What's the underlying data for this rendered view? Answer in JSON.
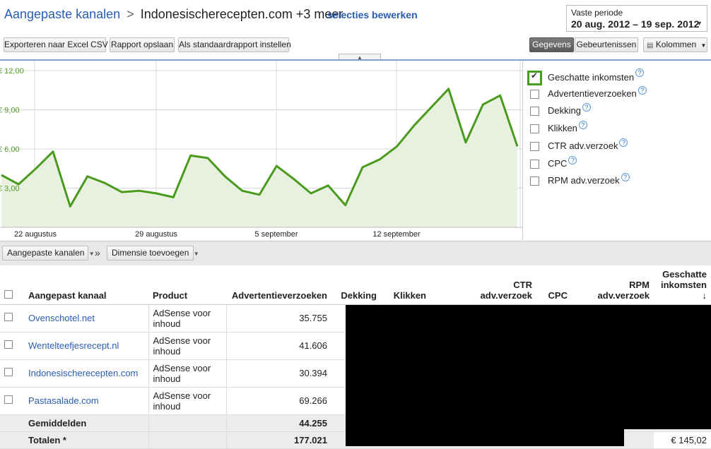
{
  "header": {
    "crumb_link": "Aangepaste kanalen",
    "crumb_sep": ">",
    "crumb_current": "Indonesischerecepten.com +3 meer",
    "edit_selection": "selecties bewerken",
    "date_label": "Vaste periode",
    "date_value": "20 aug. 2012 – 19 sep. 2012"
  },
  "toolbar": {
    "export": "Exporteren naar Excel CSV",
    "save_report": "Rapport opslaan",
    "set_default": "Als standaardrapport instellen",
    "data_tab": "Gegevens",
    "events_tab": "Gebeurtenissen",
    "columns": "Kolommen"
  },
  "chart_data": {
    "type": "area",
    "series": [
      {
        "name": "Geschatte inkomsten",
        "values": [
          4.0,
          3.3,
          4.5,
          5.8,
          1.6,
          3.9,
          3.4,
          2.7,
          2.8,
          2.6,
          2.3,
          5.5,
          5.3,
          3.9,
          2.8,
          2.5,
          4.7,
          3.7,
          2.6,
          3.2,
          1.7,
          4.6,
          5.2,
          6.2,
          7.8,
          9.2,
          10.6,
          6.5,
          9.4,
          10.1,
          6.2
        ]
      }
    ],
    "x_labels": [
      "22 augustus",
      "29 augustus",
      "5 september",
      "12 september"
    ],
    "y_ticks": [
      "€ 12,00",
      "€ 9,00",
      "€ 6,00",
      "€ 3,00"
    ],
    "ylim": [
      0,
      12
    ],
    "grid": true,
    "line_color": "#4a9a1e",
    "fill_color": "#e8f1e0"
  },
  "metrics": [
    {
      "label": "Geschatte inkomsten",
      "checked": true
    },
    {
      "label": "Advertentieverzoeken",
      "checked": false
    },
    {
      "label": "Dekking",
      "checked": false
    },
    {
      "label": "Klikken",
      "checked": false
    },
    {
      "label": "CTR adv.verzoek",
      "checked": false
    },
    {
      "label": "CPC",
      "checked": false
    },
    {
      "label": "RPM adv.verzoek",
      "checked": false
    }
  ],
  "help_icon": "?",
  "dimbar": {
    "channels": "Aangepaste kanalen",
    "arrow": "»",
    "add_dimension": "Dimensie toevoegen"
  },
  "table": {
    "headers": {
      "channel": "Aangepast kanaal",
      "product": "Product",
      "requests": "Advertentieverzoeken",
      "coverage": "Dekking",
      "clicks": "Klikken",
      "ctr_1": "CTR",
      "ctr_2": "adv.verzoek",
      "cpc": "CPC",
      "rpm_1": "RPM",
      "rpm_2": "adv.verzoek",
      "earnings_1": "Geschatte",
      "earnings_2": "inkomsten",
      "sort_arrow": "↓"
    },
    "rows": [
      {
        "channel": "Ovenschotel.net",
        "product": "AdSense voor inhoud",
        "requests": "35.755"
      },
      {
        "channel": "Wentelteefjesrecept.nl",
        "product": "AdSense voor inhoud",
        "requests": "41.606"
      },
      {
        "channel": "Indonesischerecepten.com",
        "product": "AdSense voor inhoud",
        "requests": "30.394"
      },
      {
        "channel": "Pastasalade.com",
        "product": "AdSense voor inhoud",
        "requests": "69.266"
      }
    ],
    "avg_label": "Gemiddelden",
    "avg_requests": "44.255",
    "total_label": "Totalen *",
    "total_requests": "177.021",
    "total_earnings": "€ 145,02"
  }
}
